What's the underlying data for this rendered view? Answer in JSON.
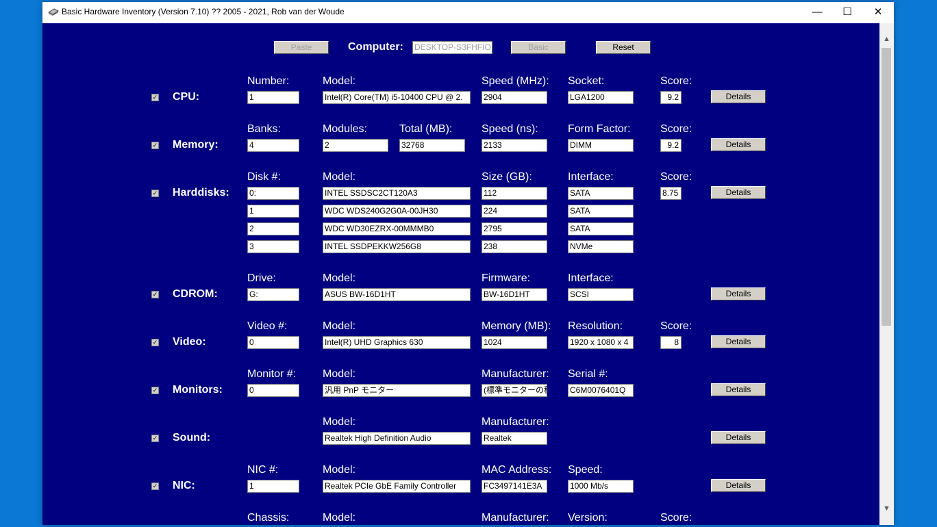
{
  "window": {
    "title": "Basic Hardware Inventory (Version 7.10) ?? 2005 - 2021, Rob van der Woude",
    "minimize": "—",
    "maximize": "☐",
    "close": "✕"
  },
  "toolbar": {
    "paste_label": "Paste",
    "computer_label": "Computer:",
    "computer_value": "DESKTOP-S3FHFIO",
    "basic_label": "Basic",
    "reset_label": "Reset"
  },
  "details_label": "Details",
  "check_mark": "✓",
  "rows": {
    "cpu": {
      "label": "CPU:",
      "h_number": "Number:",
      "h_model": "Model:",
      "h_speed": "Speed (MHz):",
      "h_socket": "Socket:",
      "h_score": "Score:",
      "number": "1",
      "model": "Intel(R) Core(TM) i5-10400 CPU @ 2.",
      "speed": "2904",
      "socket": "LGA1200",
      "score": "9.2"
    },
    "memory": {
      "label": "Memory:",
      "h_banks": "Banks:",
      "h_modules": "Modules:",
      "h_total": "Total (MB):",
      "h_speed": "Speed (ns):",
      "h_form": "Form Factor:",
      "h_score": "Score:",
      "banks": "4",
      "modules": "2",
      "total": "32768",
      "speed": "2133",
      "form": "DIMM",
      "score": "9.2"
    },
    "harddisks": {
      "label": "Harddisks:",
      "h_disk": "Disk #:",
      "h_model": "Model:",
      "h_size": "Size (GB):",
      "h_interface": "Interface:",
      "h_score": "Score:",
      "score": "8.75",
      "disks": [
        {
          "num": "0:",
          "model": "INTEL SSDSC2CT120A3",
          "size": "112",
          "iface": "SATA"
        },
        {
          "num": "1",
          "model": "WDC WDS240G2G0A-00JH30",
          "size": "224",
          "iface": "SATA"
        },
        {
          "num": "2",
          "model": "WDC WD30EZRX-00MMMB0",
          "size": "2795",
          "iface": "SATA"
        },
        {
          "num": "3",
          "model": "INTEL SSDPEKKW256G8",
          "size": "238",
          "iface": "NVMe"
        }
      ]
    },
    "cdrom": {
      "label": "CDROM:",
      "h_drive": "Drive:",
      "h_model": "Model:",
      "h_firmware": "Firmware:",
      "h_interface": "Interface:",
      "drive": "G:",
      "model": "ASUS BW-16D1HT",
      "firmware": "BW-16D1HT",
      "interface": "SCSI"
    },
    "video": {
      "label": "Video:",
      "h_video": "Video #:",
      "h_model": "Model:",
      "h_memory": "Memory (MB):",
      "h_resolution": "Resolution:",
      "h_score": "Score:",
      "video": "0",
      "model": "Intel(R) UHD Graphics 630",
      "memory": "1024",
      "resolution": "1920 x 1080 x 4",
      "score": "8"
    },
    "monitors": {
      "label": "Monitors:",
      "h_monitor": "Monitor #:",
      "h_model": "Model:",
      "h_manufacturer": "Manufacturer:",
      "h_serial": "Serial #:",
      "monitor": "0",
      "model": "汎用 PnP モニター",
      "manufacturer": "(標準モニターの種",
      "serial": "C6M0076401Q"
    },
    "sound": {
      "label": "Sound:",
      "h_model": "Model:",
      "h_manufacturer": "Manufacturer:",
      "model": "Realtek High Definition Audio",
      "manufacturer": "Realtek"
    },
    "nic": {
      "label": "NIC:",
      "h_nic": "NIC #:",
      "h_model": "Model:",
      "h_mac": "MAC Address:",
      "h_speed": "Speed:",
      "nic": "1",
      "model": "Realtek PCIe GbE Family Controller",
      "mac": "FC3497141E3A",
      "speed": "1000 Mb/s"
    },
    "chassis": {
      "h_chassis": "Chassis:",
      "h_model": "Model:",
      "h_manufacturer": "Manufacturer:",
      "h_version": "Version:",
      "h_score": "Score:"
    }
  }
}
